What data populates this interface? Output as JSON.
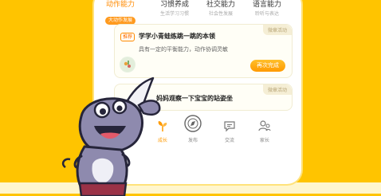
{
  "tabs": [
    {
      "title": "动作能力",
      "subtitle": "大动作发展",
      "active": true
    },
    {
      "title": "习惯养成",
      "subtitle": "生活学习习惯",
      "active": false
    },
    {
      "title": "社交能力",
      "subtitle": "社会性发展",
      "active": false
    },
    {
      "title": "语言能力",
      "subtitle": "聆听与表达",
      "active": false
    }
  ],
  "card1": {
    "badge": "微章活动",
    "tag": "推荐",
    "title": "学学小青蛙练跳一跳的本领",
    "description": "具有一定的平衡能力，动作协调灵敏",
    "button": "再次完成"
  },
  "card2": {
    "badge": "微章活动",
    "title": "妈妈观察一下宝宝的站姿坐"
  },
  "nav": [
    {
      "label": "成长",
      "icon": "sprout-icon",
      "active": true
    },
    {
      "label": "发布",
      "icon": "compass-icon",
      "active": false
    },
    {
      "label": "交流",
      "icon": "chat-icon",
      "active": false
    },
    {
      "label": "家长",
      "icon": "parent-icon",
      "active": false
    }
  ],
  "colors": {
    "background": "#FFC400",
    "accent": "#FF9A00",
    "mascot": "#8E8AAE"
  }
}
